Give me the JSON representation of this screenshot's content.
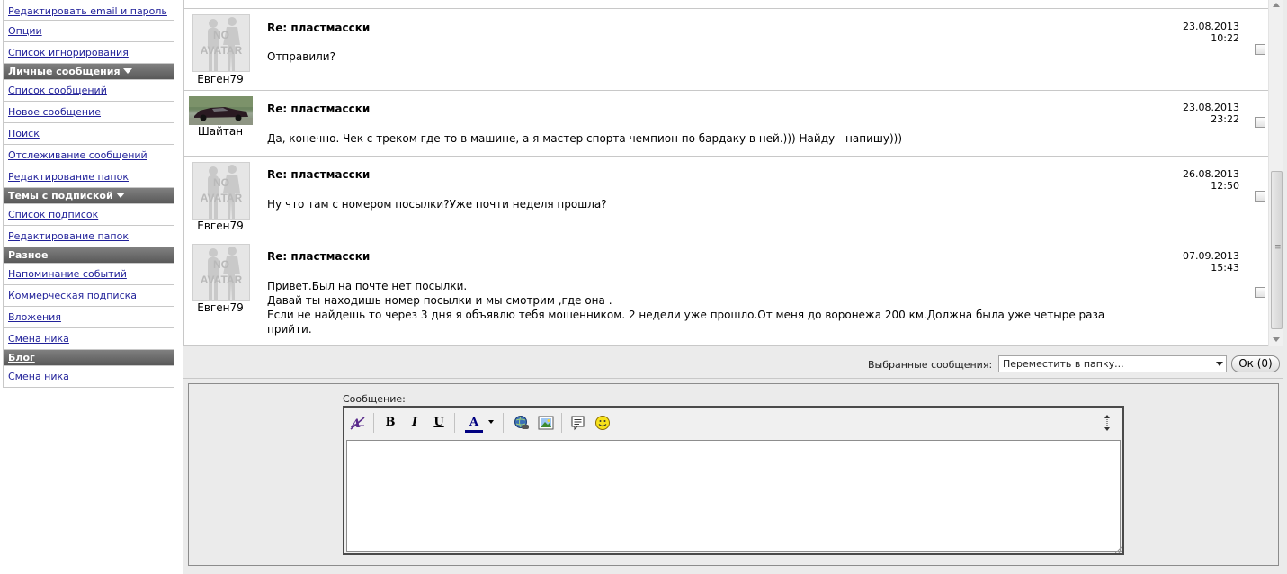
{
  "sidebar": {
    "group1": [
      {
        "label": "Редактировать email и пароль"
      },
      {
        "label": "Опции"
      },
      {
        "label": "Список игнорирования"
      }
    ],
    "group2": {
      "title": "Личные сообщения",
      "items": [
        {
          "label": "Список сообщений"
        },
        {
          "label": "Новое сообщение"
        },
        {
          "label": "Поиск"
        },
        {
          "label": "Отслеживание сообщений"
        },
        {
          "label": "Редактирование папок"
        }
      ]
    },
    "group3": {
      "title": "Темы с подпиской",
      "items": [
        {
          "label": "Список подписок"
        },
        {
          "label": "Редактирование папок"
        }
      ]
    },
    "group4": {
      "title": "Разное",
      "items": [
        {
          "label": "Напоминание событий"
        },
        {
          "label": "Коммерческая подписка"
        },
        {
          "label": "Вложения"
        },
        {
          "label": "Смена ника"
        }
      ]
    },
    "group5": {
      "title": "Блог",
      "items": [
        {
          "label": "Смена ника"
        }
      ]
    }
  },
  "messages": [
    {
      "author": "Евген79",
      "avatar": "no-avatar",
      "avatar_text": [
        "NO",
        "AVATAR"
      ],
      "subject": "Re: пластмасски",
      "date": "23.08.2013",
      "time": "10:22",
      "lines": [
        "Отправили?"
      ]
    },
    {
      "author": "Шайтан",
      "avatar": "car-photo",
      "subject": "Re: пластмасски",
      "date": "23.08.2013",
      "time": "23:22",
      "lines": [
        "Да, конечно. Чек с треком где-то в машине, а я мастер спорта чемпион по бардаку в ней.))) Найду - напишу)))"
      ]
    },
    {
      "author": "Евген79",
      "avatar": "no-avatar",
      "avatar_text": [
        "NO",
        "AVATAR"
      ],
      "subject": "Re: пластмасски",
      "date": "26.08.2013",
      "time": "12:50",
      "lines": [
        "Ну что там с номером посылки?Уже почти неделя прошла?"
      ]
    },
    {
      "author": "Евген79",
      "avatar": "no-avatar",
      "avatar_text": [
        "NO",
        "AVATAR"
      ],
      "subject": "Re: пластмасски",
      "date": "07.09.2013",
      "time": "15:43",
      "lines": [
        "Привет.Был на почте нет посылки.",
        "Давай ты находишь номер посылки и мы смотрим ,где она .",
        "Если не найдешь то через 3 дня я объявлю тебя мошенником. 2 недели уже прошло.От меня до воронежа 200 км.Должна была уже четыре раза",
        "прийти."
      ]
    }
  ],
  "actions": {
    "selected_label": "Выбранные сообщения:",
    "folder_select_value": "Переместить в папку...",
    "ok_label": "Ок (0)"
  },
  "compose": {
    "label": "Сообщение:",
    "toolbar": {
      "bold": "B",
      "italic": "I",
      "underline": "U",
      "font_color": "A"
    },
    "text": ""
  },
  "colors": {
    "link": "#22229a",
    "sidebar_header": "#666666",
    "font_color_bar": "#000080"
  }
}
